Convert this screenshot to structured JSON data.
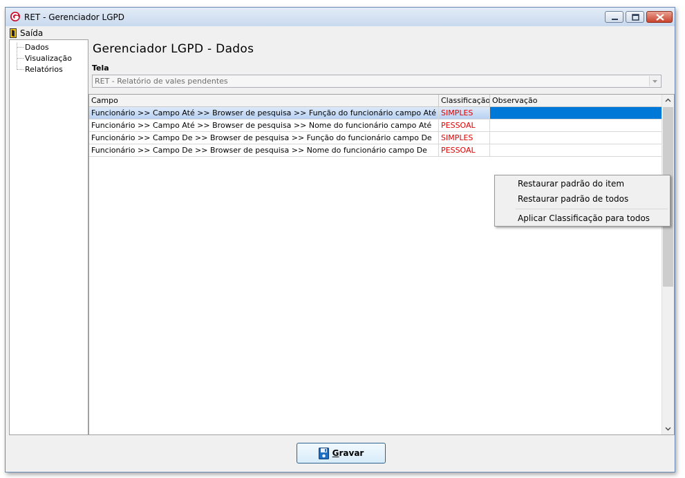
{
  "window": {
    "title": "RET - Gerenciador LGPD"
  },
  "menu": {
    "saida_label": "Saída"
  },
  "sidebar": {
    "items": [
      {
        "label": "Dados"
      },
      {
        "label": "Visualização"
      },
      {
        "label": "Relatórios"
      }
    ]
  },
  "main": {
    "title": "Gerenciador LGPD - Dados",
    "tela_label": "Tela",
    "tela_value": "RET - Relatório de vales pendentes"
  },
  "grid": {
    "columns": [
      "Campo",
      "Classificação",
      "Observação"
    ],
    "rows": [
      {
        "campo": "Funcionário >> Campo Até >> Browser de pesquisa >> Função do funcionário campo Até",
        "classificacao": "SIMPLES",
        "observacao": ""
      },
      {
        "campo": "Funcionário >> Campo Até >> Browser de pesquisa >> Nome do funcionário campo Até",
        "classificacao": "PESSOAL",
        "observacao": ""
      },
      {
        "campo": "Funcionário >> Campo De >> Browser de pesquisa >> Função do funcionário campo De",
        "classificacao": "SIMPLES",
        "observacao": ""
      },
      {
        "campo": "Funcionário >> Campo De >> Browser de pesquisa >> Nome do funcionário campo De",
        "classificacao": "PESSOAL",
        "observacao": ""
      }
    ]
  },
  "context_menu": {
    "items": [
      {
        "label": "Restaurar padrão do item"
      },
      {
        "label": "Restaurar padrão de todos"
      },
      {
        "label": "Aplicar Classificação para todos"
      }
    ]
  },
  "footer": {
    "save_label_first": "G",
    "save_label_rest": "ravar"
  },
  "colors": {
    "classification_text": "#e00000",
    "selection_blue": "#0078d7"
  },
  "icons": {
    "app": "app-logo-icon",
    "exit": "exit-door-icon",
    "save": "floppy-disk-icon"
  }
}
